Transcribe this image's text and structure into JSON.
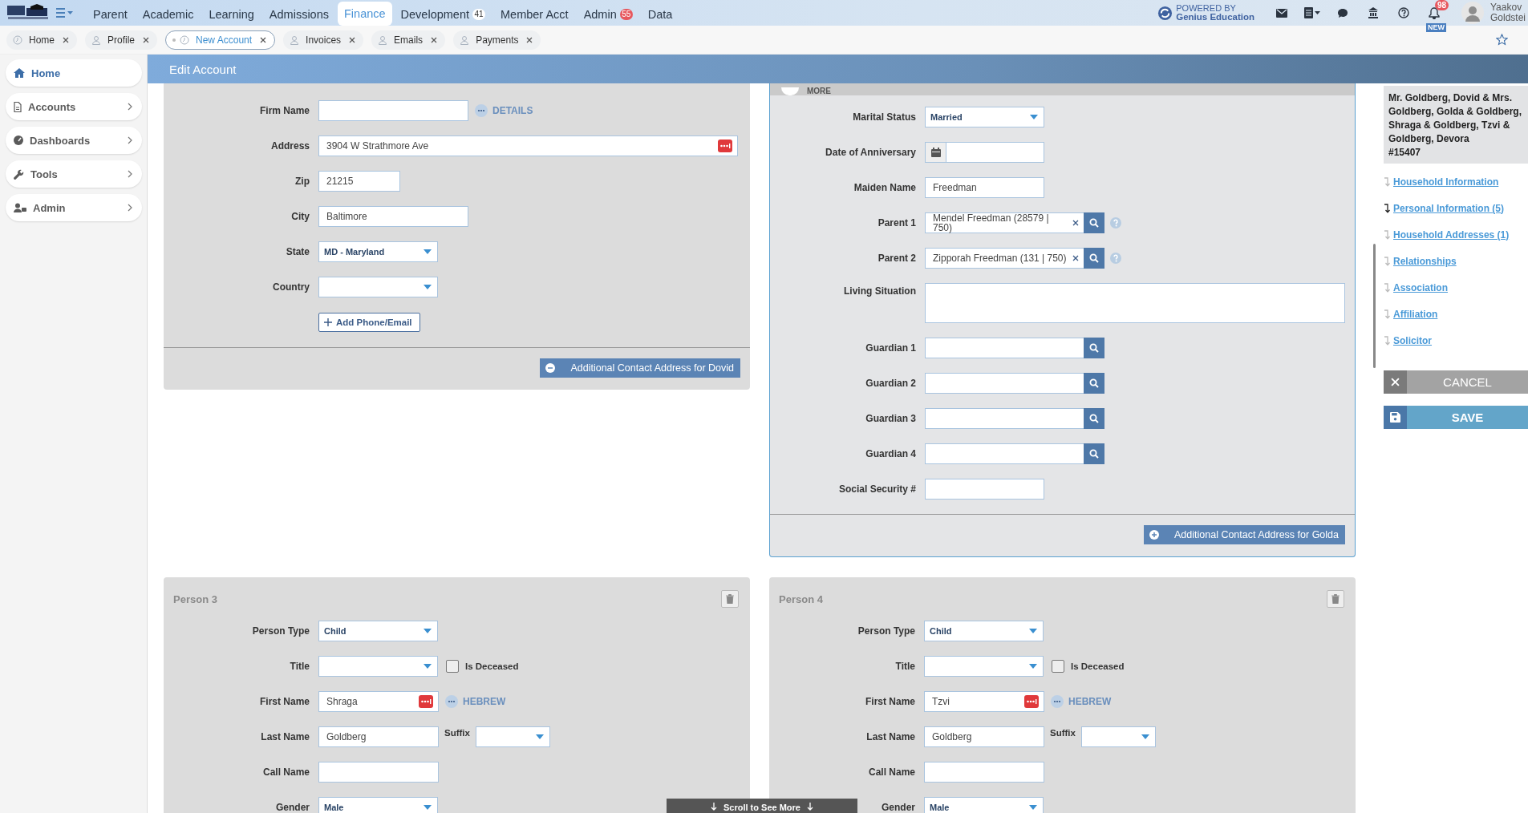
{
  "top_nav": {
    "items": [
      {
        "label": "Parent",
        "selected": false
      },
      {
        "label": "Academic",
        "selected": false
      },
      {
        "label": "Learning",
        "selected": false
      },
      {
        "label": "Admissions",
        "selected": false
      },
      {
        "label": "Finance",
        "selected": true
      },
      {
        "label": "Development",
        "selected": false,
        "badge": {
          "text": "41",
          "color": "#ffffff"
        }
      },
      {
        "label": "Member Acct",
        "selected": false
      },
      {
        "label": "Admin",
        "selected": false,
        "badge": {
          "text": "55",
          "color": "#e7585e"
        }
      },
      {
        "label": "Data",
        "selected": false
      }
    ],
    "powered_by": {
      "line1": "POWERED BY",
      "line2": "Genius Education"
    },
    "notifications": {
      "count": "98",
      "tag": "NEW"
    },
    "user": {
      "first": "Yaakov",
      "last": "Goldstei"
    }
  },
  "open_tabs": [
    {
      "label": "Home",
      "selected": false,
      "kind": "clock"
    },
    {
      "label": "Profile",
      "selected": false,
      "kind": "person"
    },
    {
      "label": "New Account",
      "selected": true,
      "kind": "clock"
    },
    {
      "label": "Invoices",
      "selected": false,
      "kind": "person"
    },
    {
      "label": "Emails",
      "selected": false,
      "kind": "person"
    },
    {
      "label": "Payments",
      "selected": false,
      "kind": "person"
    }
  ],
  "sidebar": {
    "items": [
      {
        "label": "Home",
        "selected": true,
        "kind": "home"
      },
      {
        "label": "Accounts",
        "selected": false,
        "kind": "doc"
      },
      {
        "label": "Dashboards",
        "selected": false,
        "kind": "gauge"
      },
      {
        "label": "Tools",
        "selected": false,
        "kind": "wrench"
      },
      {
        "label": "Admin",
        "selected": false,
        "kind": "users"
      }
    ]
  },
  "page_title": "Edit Account",
  "address_section": {
    "firm_name": {
      "label": "Firm Name",
      "link": "DETAILS"
    },
    "address": {
      "label": "Address",
      "value": "3904 W Strathmore Ave"
    },
    "zip": {
      "label": "Zip",
      "value": "21215"
    },
    "city": {
      "label": "City",
      "value": "Baltimore"
    },
    "state": {
      "label": "State",
      "value": "MD - Maryland"
    },
    "country": {
      "label": "Country"
    },
    "add_button": "Add Phone/Email",
    "footer_button": "Additional Contact Address for Dovid"
  },
  "more_section": {
    "toggle_label": "MORE",
    "fields": [
      {
        "kind": "select",
        "label": "Marital Status",
        "value": "Married"
      },
      {
        "kind": "date",
        "label": "Date of Anniversary"
      },
      {
        "kind": "text",
        "label": "Maiden Name",
        "value": "Freedman"
      },
      {
        "kind": "lookup",
        "label": "Parent 1",
        "value": "Mendel Freedman (28579 | 750)",
        "help": true
      },
      {
        "kind": "lookup",
        "label": "Parent 2",
        "value": "Zipporah Freedman (131 | 750)",
        "help": true
      },
      {
        "kind": "textarea",
        "label": "Living Situation"
      },
      {
        "kind": "lookup",
        "label": "Guardian 1",
        "help": false
      },
      {
        "kind": "lookup",
        "label": "Guardian 2",
        "help": false
      },
      {
        "kind": "lookup",
        "label": "Guardian 3",
        "help": false
      },
      {
        "kind": "lookup",
        "label": "Guardian 4",
        "help": false
      },
      {
        "kind": "text",
        "label": "Social Security #"
      }
    ],
    "footer_button": "Additional Contact Address for Golda"
  },
  "persons": [
    {
      "title": "Person 3",
      "fields": [
        {
          "kind": "select",
          "label": "Person Type",
          "value": "Child"
        },
        {
          "kind": "select",
          "label": "Title",
          "deceased": {
            "label": "Is Deceased",
            "checked": false
          }
        },
        {
          "kind": "name",
          "label": "First Name",
          "value": "Shraga",
          "link": "HEBREW"
        },
        {
          "kind": "text",
          "label": "Last Name",
          "value": "Goldberg",
          "suffix": "Suffix"
        },
        {
          "kind": "text",
          "label": "Call Name"
        },
        {
          "kind": "select",
          "label": "Gender",
          "value": "Male"
        }
      ]
    },
    {
      "title": "Person 4",
      "fields": [
        {
          "kind": "select",
          "label": "Person Type",
          "value": "Child"
        },
        {
          "kind": "select",
          "label": "Title",
          "deceased": {
            "label": "Is Deceased",
            "checked": false
          }
        },
        {
          "kind": "name",
          "label": "First Name",
          "value": "Tzvi",
          "link": "HEBREW"
        },
        {
          "kind": "text",
          "label": "Last Name",
          "value": "Goldberg",
          "suffix": "Suffix"
        },
        {
          "kind": "text",
          "label": "Call Name"
        },
        {
          "kind": "select",
          "label": "Gender",
          "value": "Male"
        }
      ]
    }
  ],
  "scroll_hint": "Scroll to See More",
  "account_summary": {
    "names": "Mr. Goldberg, Dovid & Mrs. Goldberg, Golda & Goldberg, Shraga & Goldberg, Tzvi & Goldberg, Devora",
    "number": "#15407"
  },
  "section_links": [
    {
      "label": "Household Information",
      "selected": false
    },
    {
      "label": "Personal Information (5)",
      "selected": true
    },
    {
      "label": "Household Addresses (1)",
      "selected": false
    },
    {
      "label": "Relationships",
      "selected": false
    },
    {
      "label": "Association",
      "selected": false
    },
    {
      "label": "Affiliation",
      "selected": false
    },
    {
      "label": "Solicitor",
      "selected": false
    }
  ],
  "cancel_button": "CANCEL",
  "save_button": "SAVE"
}
